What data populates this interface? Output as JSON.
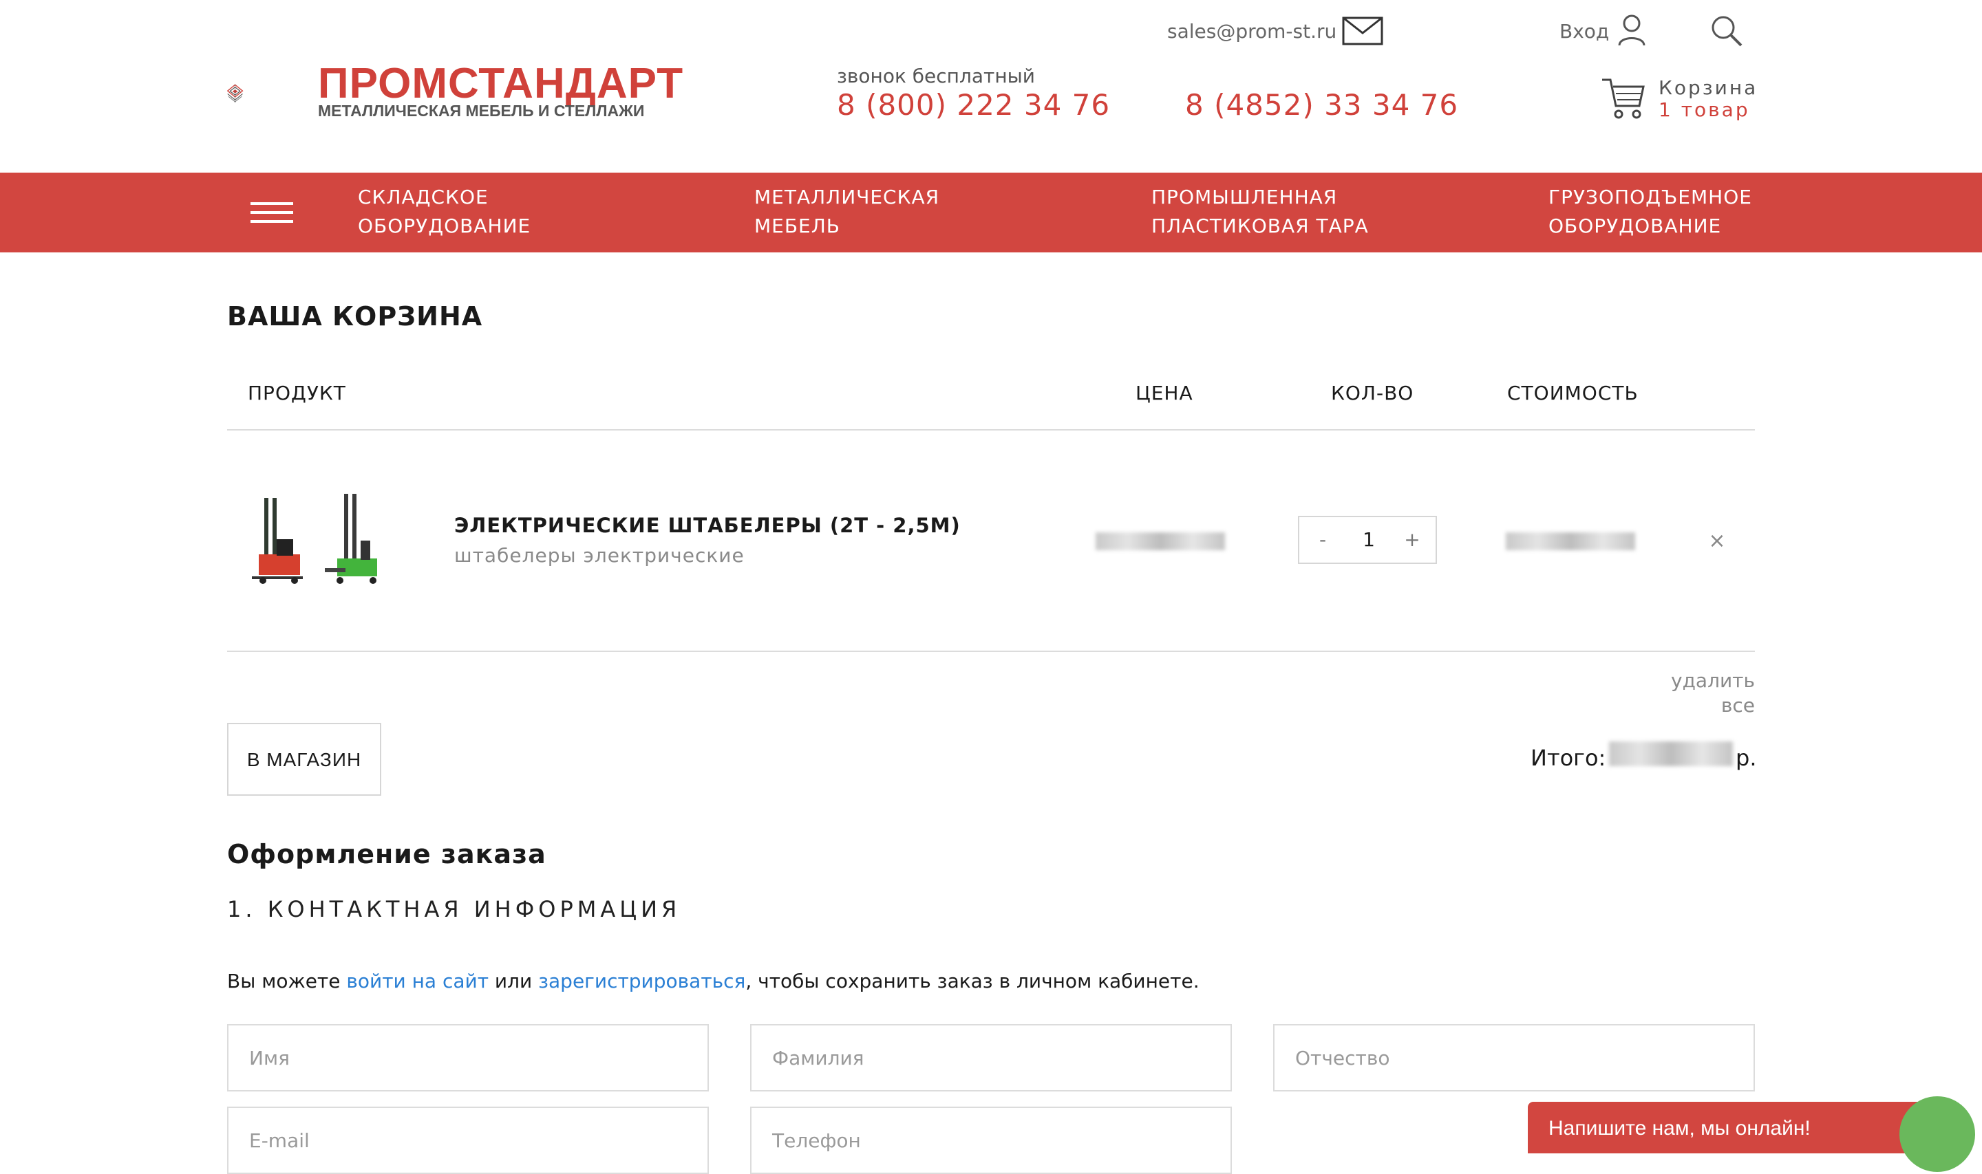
{
  "header": {
    "logo_title": "ПРОМСТАНДАРТ",
    "logo_subtitle": "МЕТАЛЛИЧЕСКАЯ МЕБЕЛЬ И СТЕЛЛАЖИ",
    "email": "sales@prom-st.ru",
    "login": "Вход",
    "free_call_label": "звонок бесплатный",
    "phone_free": "8 (800) 222 34 76",
    "phone_local": "8 (4852) 33 34 76",
    "cart_label": "Корзина",
    "cart_count": "1 товар",
    "icons": [
      "mail-icon",
      "user-icon",
      "search-icon",
      "cart-icon"
    ]
  },
  "nav": {
    "menu_icon": "hamburger-icon",
    "items": [
      {
        "line1": "СКЛАДСКОЕ",
        "line2": "ОБОРУДОВАНИЕ"
      },
      {
        "line1": "МЕТАЛЛИЧЕСКАЯ",
        "line2": "МЕБЕЛЬ"
      },
      {
        "line1": "ПРОМЫШЛЕННАЯ",
        "line2": "ПЛАСТИКОВАЯ ТАРА"
      },
      {
        "line1": "ГРУЗОПОДЪЕМНОЕ",
        "line2": "ОБОРУДОВАНИЕ"
      }
    ]
  },
  "cart": {
    "title": "ВАША КОРЗИНА",
    "columns": {
      "product": "ПРОДУКТ",
      "price": "ЦЕНА",
      "qty": "КОЛ-ВО",
      "cost": "СТОИМОСТЬ"
    },
    "items": [
      {
        "name": "ЭЛЕКТРИЧЕСКИЕ ШТАБЕЛЕРЫ (2Т - 2,5М)",
        "category": "штабелеры электрические",
        "qty_minus": "-",
        "quantity": "1",
        "qty_plus": "+",
        "remove": "×"
      }
    ],
    "delete_all": "удалить все",
    "shop_button": "В МАГАЗИН",
    "total_label": "Итого:",
    "total_currency": "р."
  },
  "checkout": {
    "title": "Оформление заказа",
    "step1": "1. КОНТАКТНАЯ ИНФОРМАЦИЯ",
    "note_before": "Вы можете ",
    "note_login_link": "войти на сайт",
    "note_middle": " или ",
    "note_register_link": "зарегистрироваться",
    "note_after": ", чтобы сохранить заказ в личном кабинете.",
    "fields": {
      "first_name": "Имя",
      "last_name": "Фамилия",
      "patronymic": "Отчество",
      "email": "E-mail",
      "phone": "Телефон"
    }
  },
  "chat": {
    "text": "Напишите нам, мы онлайн!"
  },
  "colors": {
    "brand_red": "#d24640",
    "accent_red_text": "#d0413a",
    "link_blue": "#2a7fd4",
    "chat_green": "#6ab85c"
  }
}
